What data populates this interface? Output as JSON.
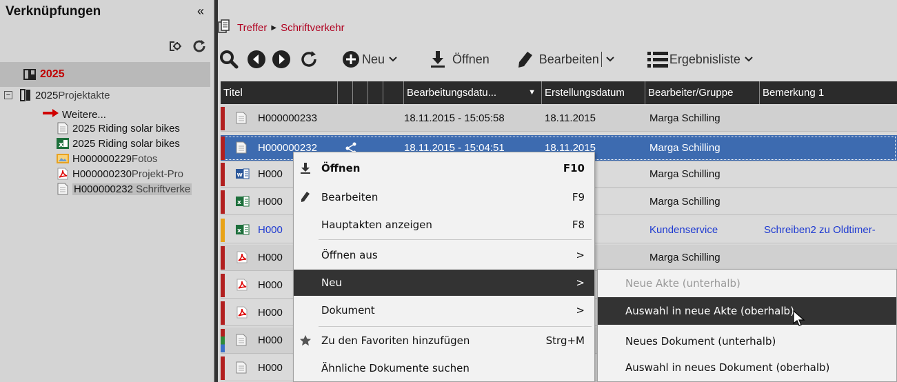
{
  "left": {
    "title": "Verknüpfungen",
    "collapse": "«",
    "year": "2025",
    "tree": [
      {
        "main": "2025",
        "sub": " Projektakte",
        "icon": "binder-icon"
      },
      {
        "main": "Weitere...",
        "sub": "",
        "icon": "arrow-right-icon"
      },
      {
        "main": "2025  Riding solar bikes",
        "sub": "",
        "icon": "document-icon"
      },
      {
        "main": "2025  Riding solar bikes",
        "sub": "",
        "icon": "excel-icon"
      },
      {
        "main": "H000000229",
        "sub": " Fotos",
        "icon": "image-icon"
      },
      {
        "main": "H000000230",
        "sub": " Projekt-Pro",
        "icon": "pdf-icon"
      },
      {
        "main": "H000000232",
        "sub": " Schriftverke",
        "icon": "document-icon"
      }
    ]
  },
  "breadcrumb": [
    "Treffer",
    "Schriftverkehr"
  ],
  "toolbar": {
    "new": "Neu",
    "open": "Öffnen",
    "edit": "Bearbeiten",
    "results": "Ergebnisliste"
  },
  "grid": {
    "headers": {
      "title": "Titel",
      "edit_date": "Bearbeitungsdatu...",
      "create_date": "Erstellungsdatum",
      "editor": "Bearbeiter/Gruppe",
      "remark": "Bemerkung 1"
    },
    "rows": [
      {
        "title": "H000000233",
        "edit": "18.11.2015 - 15:05:58",
        "create": "18.11.2015",
        "editor": "Marga Schilling",
        "remark": "",
        "stripe": "#b21f1f",
        "icon": "document-icon"
      },
      {
        "title": "H000000232",
        "edit": "18.11.2015 - 15:04:51",
        "create": "18.11.2015",
        "editor": "Marga Schilling",
        "remark": "",
        "stripe": "#b21f1f",
        "icon": "document-icon"
      },
      {
        "title": "H000",
        "edit": "",
        "create": "5",
        "editor": "Marga Schilling",
        "remark": "",
        "stripe": "#b21f1f",
        "icon": "word-icon"
      },
      {
        "title": "H000",
        "edit": "",
        "create": "5",
        "editor": "Marga Schilling",
        "remark": "",
        "stripe": "#b21f1f",
        "icon": "excel-icon"
      },
      {
        "title": "H000",
        "edit": "",
        "create": "15",
        "editor": "Kundenservice",
        "remark": "Schreiben2 zu Oldtimer-",
        "stripe": "#e8a317",
        "icon": "excel-icon"
      },
      {
        "title": "H000",
        "edit": "",
        "create": "5",
        "editor": "Marga Schilling",
        "remark": "",
        "stripe": "#b21f1f",
        "icon": "pdf-icon"
      },
      {
        "title": "H000",
        "edit": "",
        "create": "",
        "editor": "",
        "remark": "",
        "stripe": "#b21f1f",
        "icon": "pdf-icon"
      },
      {
        "title": "H000",
        "edit": "",
        "create": "",
        "editor": "",
        "remark": "",
        "stripe": "#b21f1f",
        "icon": "pdf-icon"
      },
      {
        "title": "H000",
        "edit": "",
        "create": "",
        "editor": "",
        "remark": "",
        "stripe": "multi",
        "icon": "document-icon"
      },
      {
        "title": "H000",
        "edit": "",
        "create": "",
        "editor": "",
        "remark": "",
        "stripe": "#b21f1f",
        "icon": "document-icon"
      }
    ]
  },
  "context_menu": {
    "items": [
      {
        "label": "Öffnen",
        "shortcut": "F10",
        "icon": "download-icon",
        "bold": true
      },
      {
        "label": "Bearbeiten",
        "shortcut": "F9",
        "icon": "pencil-icon"
      },
      {
        "label": "Hauptakten anzeigen",
        "shortcut": "F8",
        "icon": ""
      },
      {
        "label": "Öffnen aus",
        "shortcut": ">",
        "icon": ""
      },
      {
        "label": "Neu",
        "shortcut": ">",
        "icon": ""
      },
      {
        "label": "Dokument",
        "shortcut": ">",
        "icon": ""
      },
      {
        "label": "Zu den Favoriten hinzufügen",
        "shortcut": "Strg+M",
        "icon": "star-icon"
      },
      {
        "label": "Ähnliche Dokumente suchen",
        "shortcut": "",
        "icon": ""
      }
    ]
  },
  "submenu": {
    "items": [
      {
        "label": "Neue Akte (unterhalb)",
        "state": "disabled"
      },
      {
        "label": "Auswahl in neue Akte (oberhalb)",
        "state": "active"
      },
      {
        "label": "Neues Dokument (unterhalb)",
        "state": "normal"
      },
      {
        "label": "Auswahl in neues Dokument (oberhalb)",
        "state": "normal"
      }
    ]
  },
  "colors": {
    "accent_red": "#c00000",
    "selected_row": "#3d6bb0",
    "menu_active": "#333333",
    "link_blue": "#1f3bd1"
  }
}
